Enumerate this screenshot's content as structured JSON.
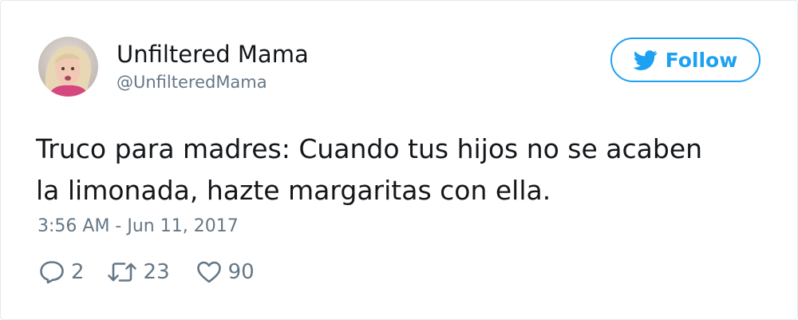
{
  "user": {
    "display_name": "Unfiltered Mama",
    "handle": "@UnfilteredMama",
    "avatar_icon": "profile-photo"
  },
  "follow_button": {
    "label": "Follow",
    "icon": "twitter-bird-icon",
    "color": "#1da1f2"
  },
  "tweet": {
    "lines": [
      "Truco para madres: Cuando tus hijos no se acaben",
      "la limonada, hazte margaritas con ella."
    ],
    "timestamp": "3:56 AM - Jun 11, 2017"
  },
  "actions": {
    "reply": {
      "icon": "reply-icon",
      "count": "2"
    },
    "retweet": {
      "icon": "retweet-icon",
      "count": "23"
    },
    "like": {
      "icon": "heart-icon",
      "count": "90"
    }
  },
  "colors": {
    "text": "#14171a",
    "muted": "#657786",
    "accent": "#1da1f2",
    "border": "#e1e8ed"
  }
}
